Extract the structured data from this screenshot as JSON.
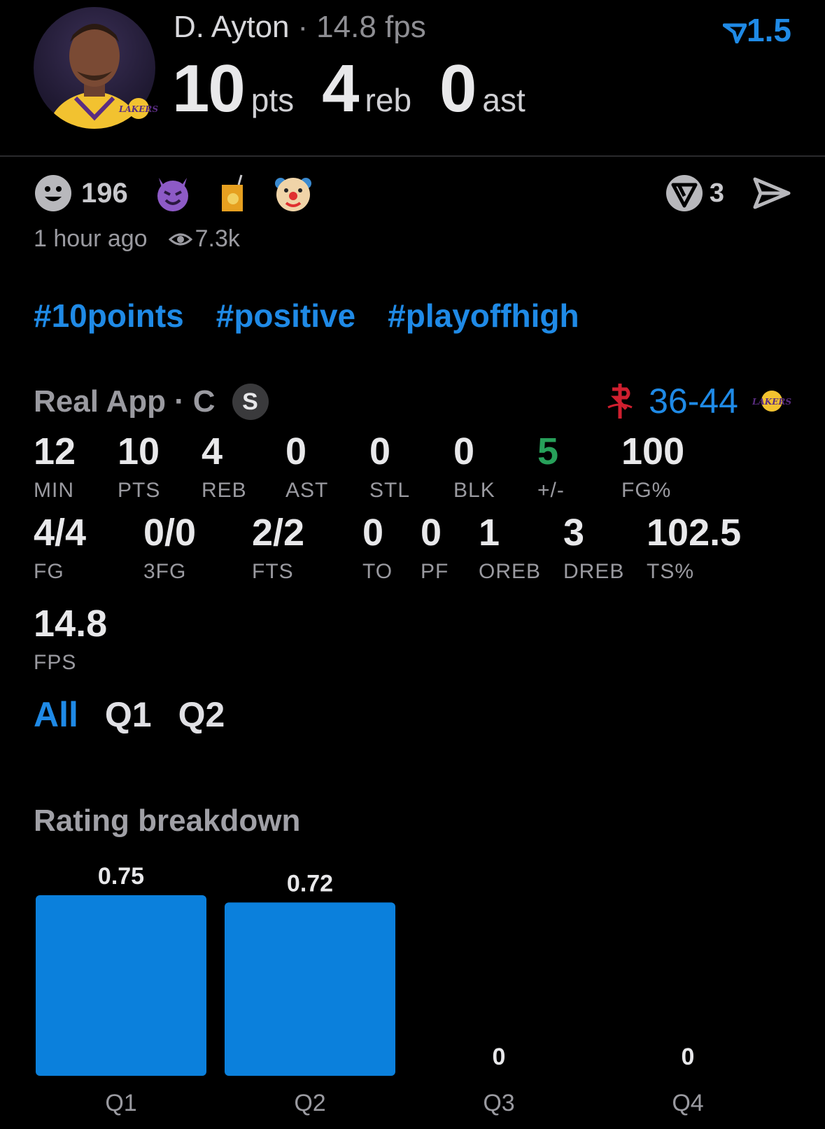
{
  "player": {
    "name": "D. Ayton",
    "separator": "·",
    "fps_label": "14.8 fps",
    "pts": "10",
    "pts_unit": "pts",
    "reb": "4",
    "reb_unit": "reb",
    "ast": "0",
    "ast_unit": "ast",
    "rating": "1.5",
    "team_logo_text": "LAKERS"
  },
  "reactions": {
    "count": "196",
    "replies": "3",
    "time": "1 hour ago",
    "views": "7.3k"
  },
  "hashtags": [
    "#10points",
    "#positive",
    "#playoffhigh"
  ],
  "game": {
    "app": "Real App",
    "separator": "·",
    "position": "C",
    "badge": "S",
    "score": "36-44",
    "home_logo_text": "LAKERS"
  },
  "stats_row1": [
    {
      "value": "12",
      "label": "MIN"
    },
    {
      "value": "10",
      "label": "PTS"
    },
    {
      "value": "4",
      "label": "REB"
    },
    {
      "value": "0",
      "label": "AST"
    },
    {
      "value": "0",
      "label": "STL"
    },
    {
      "value": "0",
      "label": "BLK"
    },
    {
      "value": "5",
      "label": "+/-"
    },
    {
      "value": "100",
      "label": "FG%"
    }
  ],
  "stats_row2": [
    {
      "value": "4/4",
      "label": "FG"
    },
    {
      "value": "0/0",
      "label": "3FG"
    },
    {
      "value": "2/2",
      "label": "FTS"
    },
    {
      "value": "0",
      "label": "TO"
    },
    {
      "value": "0",
      "label": "PF"
    },
    {
      "value": "1",
      "label": "OREB"
    },
    {
      "value": "3",
      "label": "DREB"
    },
    {
      "value": "102.5",
      "label": "TS%"
    }
  ],
  "stats_row3": [
    {
      "value": "14.8",
      "label": "FPS"
    }
  ],
  "tabs": [
    "All",
    "Q1",
    "Q2"
  ],
  "section_title": "Rating breakdown",
  "colors": {
    "accent": "#1f8ae6",
    "positive": "#27a05a",
    "bar": "#0b80dc"
  },
  "chart_data": {
    "type": "bar",
    "categories": [
      "Q1",
      "Q2",
      "Q3",
      "Q4"
    ],
    "values": [
      0.75,
      0.72,
      0,
      0
    ],
    "value_labels": [
      "0.75",
      "0.72",
      "0",
      "0"
    ],
    "ylim": [
      0,
      0.75
    ]
  }
}
